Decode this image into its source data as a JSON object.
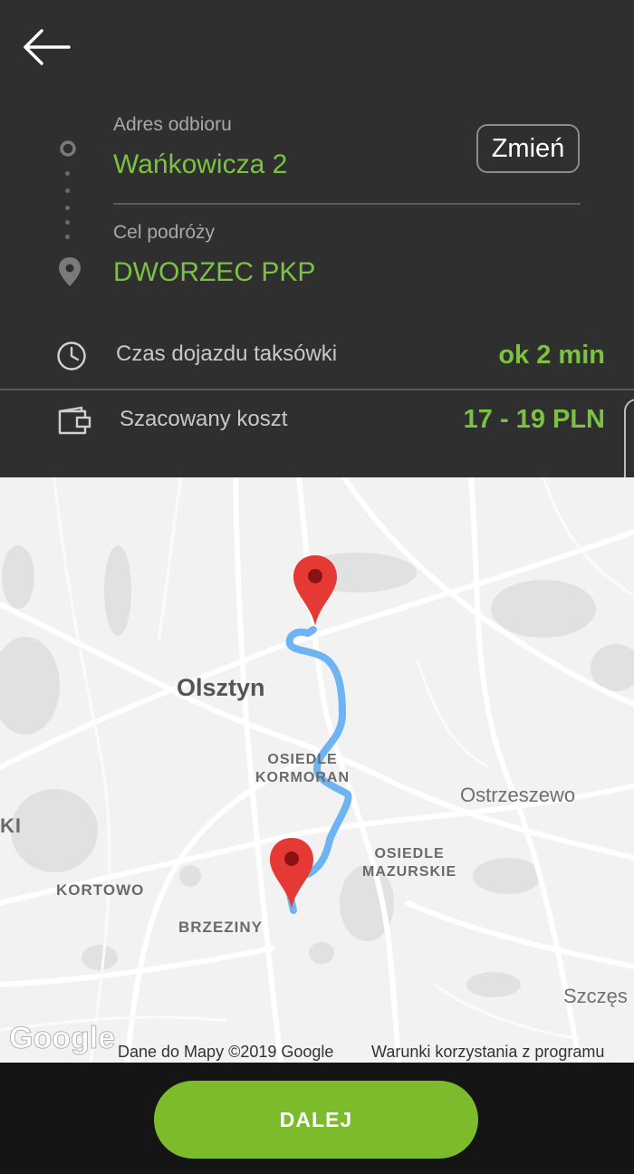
{
  "header": {
    "back_icon": "arrow-left-icon"
  },
  "pickup": {
    "label": "Adres odbioru",
    "value": "Wańkowicza 2",
    "change_button": "Zmień",
    "icon": "origin-circle-icon"
  },
  "destination": {
    "label": "Cel podróży",
    "value": "DWORZEC PKP",
    "icon": "location-pin-icon"
  },
  "info": [
    {
      "icon": "clock-icon",
      "label": "Czas dojazdu taksówki",
      "value": "ok 2 min"
    },
    {
      "icon": "wallet-icon",
      "label": "Szacowany koszt",
      "value": "17 - 19 PLN"
    }
  ],
  "map": {
    "labels": {
      "city": "Olsztyn",
      "osiedle_kormoran": "OSIEDLE\nKORMORAN",
      "ostrzeszewo": "Ostrzeszewo",
      "osiedle_mazurskie": "OSIEDLE\nMAZURSKIE",
      "kortowo": "KORTOWO",
      "brzeziny": "BRZEZINY",
      "ki": "KI",
      "szczes": "Szczęs"
    },
    "google_logo": "Google",
    "attribution": "Dane do Mapy ©2019 Google",
    "terms": "Warunki korzystania z programu",
    "route_color": "#6fb4f2",
    "pin_color": "#e53935"
  },
  "footer": {
    "next_button": "DALEJ"
  },
  "colors": {
    "accent": "#7cc242",
    "header_bg": "#2f2f2f",
    "button_bg": "#7cbb2c"
  }
}
